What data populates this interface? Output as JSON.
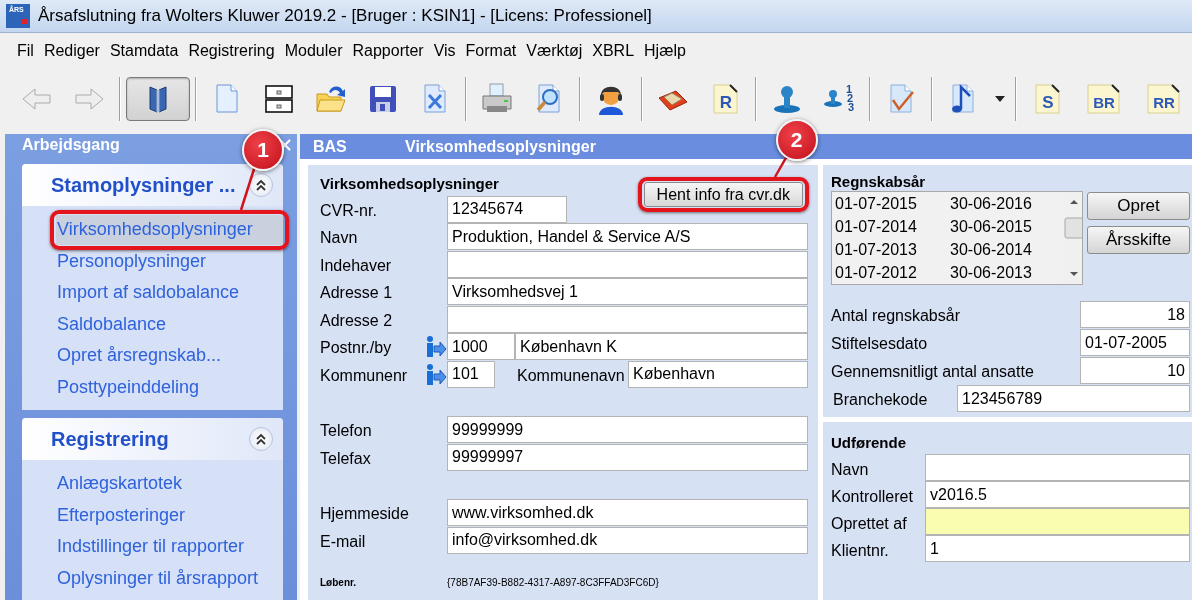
{
  "title_bar": {
    "icon_text": "ÅRS",
    "title": "Årsafslutning fra Wolters Kluwer 2019.2 - [Bruger : KSIN1] - [Licens: Professionel]"
  },
  "menu": [
    "Fil",
    "Rediger",
    "Stamdata",
    "Registrering",
    "Moduler",
    "Rapporter",
    "Vis",
    "Format",
    "Værktøj",
    "XBRL",
    "Hjælp"
  ],
  "toolbar": [
    [
      {
        "kind": "back",
        "pressed": false
      },
      {
        "kind": "forward",
        "pressed": false
      }
    ],
    [
      {
        "kind": "book",
        "pressed": true
      }
    ],
    [
      {
        "kind": "document",
        "pressed": false
      },
      {
        "kind": "cabinet",
        "pressed": false
      },
      {
        "kind": "open",
        "pressed": false
      },
      {
        "kind": "save",
        "pressed": false
      },
      {
        "kind": "close",
        "pressed": false
      }
    ],
    [
      {
        "kind": "print",
        "pressed": false
      },
      {
        "kind": "preview",
        "pressed": false
      }
    ],
    [
      {
        "kind": "user",
        "pressed": false
      }
    ],
    [
      {
        "kind": "tray",
        "pressed": false
      },
      {
        "kind": "letter",
        "label": "R",
        "pressed": false
      }
    ],
    [
      {
        "kind": "stamp",
        "pressed": false
      },
      {
        "kind": "numbered",
        "label": "123",
        "pressed": false
      }
    ],
    [
      {
        "kind": "check",
        "pressed": false
      }
    ],
    [
      {
        "kind": "note",
        "pressed": false
      },
      {
        "kind": "caret",
        "pressed": false
      }
    ],
    [
      {
        "kind": "letter",
        "label": "S",
        "pressed": false
      },
      {
        "kind": "letter",
        "label": "BR",
        "pressed": false
      },
      {
        "kind": "letter",
        "label": "RR",
        "pressed": false
      }
    ]
  ],
  "sidebar": {
    "title": "Arbejdsgang",
    "sections": [
      {
        "title": "Stamoplysninger ...",
        "expanded": true,
        "items": [
          {
            "label": "Virksomhedsoplysninger",
            "selected": true,
            "callout": "1"
          },
          {
            "label": "Personoplysninger",
            "selected": false
          },
          {
            "label": "Import af saldobalance",
            "selected": false
          },
          {
            "label": "Saldobalance",
            "selected": false
          },
          {
            "label": "Opret årsregnskab...",
            "selected": false
          },
          {
            "label": "Posttypeinddeling",
            "selected": false
          }
        ]
      },
      {
        "title": "Registrering",
        "expanded": true,
        "items": [
          {
            "label": "Anlægskartotek",
            "selected": false
          },
          {
            "label": "Efterposteringer",
            "selected": false
          },
          {
            "label": "Indstillinger til rapporter",
            "selected": false
          },
          {
            "label": "Oplysninger til årsrapport",
            "selected": false
          }
        ]
      }
    ]
  },
  "main_header": {
    "tag": "BAS",
    "title": "Virksomhedsoplysninger"
  },
  "company_form": {
    "title": "Virksomhedsoplysninger",
    "fetch_button": {
      "label": "Hent info fra cvr.dk",
      "callout": "2"
    },
    "groups": [
      [
        {
          "label": "CVR-nr.",
          "lookup": false,
          "parts": [
            {
              "kind": "short",
              "value": "12345674"
            }
          ]
        },
        {
          "label": "Navn",
          "lookup": false,
          "parts": [
            {
              "kind": "wide",
              "value": "Produktion, Handel & Service A/S"
            }
          ]
        },
        {
          "label": "Indehaver",
          "lookup": false,
          "parts": [
            {
              "kind": "wide"
            }
          ]
        },
        {
          "label": "Adresse 1",
          "lookup": false,
          "parts": [
            {
              "kind": "wide",
              "value": "Virksomhedsvej 1"
            }
          ]
        },
        {
          "label": "Adresse 2",
          "lookup": false,
          "parts": [
            {
              "kind": "wide"
            }
          ]
        },
        {
          "label": "Postnr./by",
          "lookup": true,
          "parts": [
            {
              "kind": "zip",
              "value": "1000"
            },
            {
              "kind": "wide",
              "value": "København K"
            }
          ]
        },
        {
          "label": "Kommunenr",
          "lookup": true,
          "parts": [
            {
              "kind": "tiny",
              "value": "101"
            },
            {
              "kind": "label",
              "text": "Kommunenavn"
            },
            {
              "kind": "wide",
              "value": "København"
            }
          ]
        }
      ],
      [
        {
          "label": "Telefon",
          "lookup": false,
          "parts": [
            {
              "kind": "wide",
              "value": "99999999"
            }
          ]
        },
        {
          "label": "Telefax",
          "lookup": false,
          "parts": [
            {
              "kind": "wide",
              "value": "99999997"
            }
          ]
        }
      ],
      [
        {
          "label": "Hjemmeside",
          "lookup": false,
          "parts": [
            {
              "kind": "wide",
              "value": "www.virksomhed.dk"
            }
          ]
        },
        {
          "label": "E-mail",
          "lookup": false,
          "parts": [
            {
              "kind": "wide",
              "value": "info@virksomhed.dk"
            }
          ]
        }
      ]
    ],
    "serial": {
      "label": "Løbenr.",
      "value": "{78B7AF39-B882-4317-A897-8C3FFAD3FC6D}"
    }
  },
  "fiscal_years": {
    "title": "Regnskabsår",
    "years": [
      {
        "start": "01-07-2015",
        "end": "30-06-2016",
        "selected": false
      },
      {
        "start": "01-07-2014",
        "end": "30-06-2015",
        "selected": false
      },
      {
        "start": "01-07-2013",
        "end": "30-06-2014",
        "selected": false
      },
      {
        "start": "01-07-2012",
        "end": "30-06-2013",
        "selected": false
      }
    ],
    "buttons": [
      "Opret",
      "Årsskifte"
    ],
    "fields": [
      {
        "label": "Antal regnskabsår",
        "kind": "number",
        "value": "18"
      },
      {
        "label": "Stiftelsesdato",
        "kind": "date",
        "value": "01-07-2005"
      },
      {
        "label": "Gennemsnitligt antal ansatte",
        "kind": "number",
        "value": "10"
      },
      {
        "label": "Branchekode",
        "kind": "code",
        "value": "123456789"
      }
    ]
  },
  "executor": {
    "title": "Udførende",
    "fields": [
      {
        "label": "Navn",
        "highlighted": false
      },
      {
        "label": "Kontrolleret",
        "value": "v2016.5",
        "highlighted": false
      },
      {
        "label": "Oprettet af",
        "highlighted": true
      },
      {
        "label": "Klientnr.",
        "value": "1",
        "highlighted": false
      }
    ]
  }
}
